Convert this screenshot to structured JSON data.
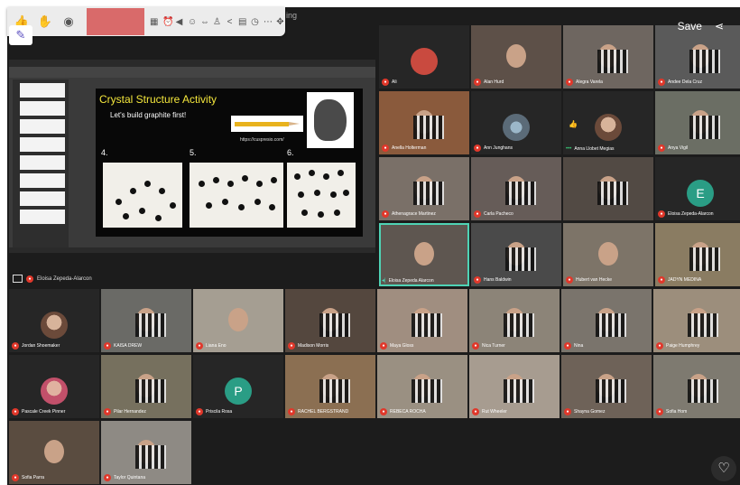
{
  "header": {
    "save_label": "Save",
    "partial_title": "ing"
  },
  "toolbar": {
    "icons": [
      "thumbs-up-icon",
      "raise-hand-icon",
      "record-icon",
      "pen-icon",
      "calendar-icon",
      "alarm-icon",
      "volume-icon",
      "emoji-icon",
      "share-icon",
      "settings-icon",
      "grid-icon",
      "move-icon"
    ]
  },
  "slide": {
    "title": "Crystal Structure Activity",
    "subtitle": "Let's build graphite first!",
    "url": "https://cuspresio.com/",
    "steps": [
      "4.",
      "5.",
      "6."
    ]
  },
  "share_presenter": "Eloisa Zepeda-Alarcon",
  "participants": [
    {
      "name": "Ali",
      "kind": "photo-avatar"
    },
    {
      "name": "Alan Hurd",
      "kind": "video"
    },
    {
      "name": "Alegra Varela",
      "kind": "video"
    },
    {
      "name": "Andee Dela Cruz",
      "kind": "video"
    },
    {
      "name": "Anella Holterman",
      "kind": "video"
    },
    {
      "name": "Ann Junghans",
      "kind": "photo-avatar"
    },
    {
      "name": "Anna Llobet Megias",
      "kind": "photo-avatar"
    },
    {
      "name": "Anya Vigil",
      "kind": "video"
    },
    {
      "name": "Athenagrace Martinez",
      "kind": "video"
    },
    {
      "name": "Carla Pacheco",
      "kind": "video"
    },
    {
      "name": "",
      "kind": "video"
    },
    {
      "name": "Eloisa Zepeda-Alarcon",
      "kind": "letter",
      "letter": "E"
    },
    {
      "name": "Eloisa Zepeda Alarcon",
      "kind": "video"
    },
    {
      "name": "Hans Baldwin",
      "kind": "video"
    },
    {
      "name": "Hubert van Hecke",
      "kind": "video"
    },
    {
      "name": "JADYN MEDINA",
      "kind": "video"
    },
    {
      "name": "Jordan Shoemaker",
      "kind": "photo-avatar"
    },
    {
      "name": "KAISA DREW",
      "kind": "video"
    },
    {
      "name": "Liana Eno",
      "kind": "video"
    },
    {
      "name": "Madison Morris",
      "kind": "video"
    },
    {
      "name": "Maya Gloss",
      "kind": "video"
    },
    {
      "name": "Nica Turner",
      "kind": "video"
    },
    {
      "name": "Nina",
      "kind": "video"
    },
    {
      "name": "Paige Humphrey",
      "kind": "video"
    },
    {
      "name": "Pascale Creek Pinner",
      "kind": "photo-avatar"
    },
    {
      "name": "Pilar Hernandez",
      "kind": "video"
    },
    {
      "name": "Priscila Rosa",
      "kind": "letter",
      "letter": "P"
    },
    {
      "name": "RACHEL BERGSTRAND",
      "kind": "video"
    },
    {
      "name": "REBECA ROCHA",
      "kind": "video"
    },
    {
      "name": "Rut Wheeler",
      "kind": "video"
    },
    {
      "name": "Shayna Gomez",
      "kind": "video"
    },
    {
      "name": "Sofia Hom",
      "kind": "video"
    },
    {
      "name": "Sofia Parra",
      "kind": "video"
    },
    {
      "name": "Taylor Quintana",
      "kind": "video"
    }
  ],
  "colors": {
    "accent_active": "#4fd3b5",
    "mic_muted": "#e0382b",
    "letter_e": "#2a9d85",
    "letter_p": "#2a9d85"
  }
}
